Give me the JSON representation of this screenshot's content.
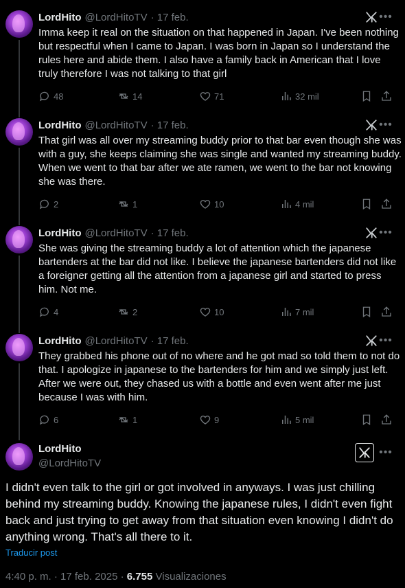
{
  "author": {
    "name": "LordHito",
    "handle": "@LordHitoTV"
  },
  "thread": [
    {
      "date": "· 17 feb.",
      "text": "Imma keep it real on the situation on that happened in Japan. I've been nothing but respectful when I came to Japan. I was born in Japan so I understand the rules here and abide them. I also have a family back in American that I love truly therefore I was not talking to that girl",
      "replies": "48",
      "reposts": "14",
      "likes": "71",
      "views": "32 mil"
    },
    {
      "date": "· 17 feb.",
      "text": "That girl was all over my streaming buddy prior to that bar even though she was with a guy, she keeps claiming she was single and wanted my streaming buddy. When we went to that bar after we ate ramen, we went to the bar not knowing she was there.",
      "replies": "2",
      "reposts": "1",
      "likes": "10",
      "views": "4 mil"
    },
    {
      "date": "· 17 feb.",
      "text": "She was giving the streaming buddy a lot of attention which the japanese bartenders at the bar did not like. I believe the japanese bartenders did not like a foreigner getting all the attention from a japanese girl and started to press him. Not me.",
      "replies": "4",
      "reposts": "2",
      "likes": "10",
      "views": "7 mil"
    },
    {
      "date": "· 17 feb.",
      "text": "They grabbed his phone out of no where and he got mad so told them to not do that. I apologize in japanese to the bartenders for him and we simply just left. After we were out, they chased us with a bottle and even went after me just because I was with him.",
      "replies": "6",
      "reposts": "1",
      "likes": "9",
      "views": "5 mil"
    }
  ],
  "main_post": {
    "text": "I didn't even talk to the girl or got involved in anyways. I was just chilling behind my streaming buddy. Knowing the japanese rules, I didn't even fight back and just trying to get away from that situation even knowing I didn't do anything wrong. That's all there to it.",
    "translate_label": "Traducir post",
    "time": "4:40 p. m. · 17 feb. 2025 · ",
    "views_count": "6.755",
    "views_label": "Visualizaciones"
  },
  "colors": {
    "background": "#000000",
    "text": "#e7e9ea",
    "muted": "#71767b",
    "link": "#1d9bf0"
  },
  "icons": [
    "reply-icon",
    "repost-icon",
    "like-icon",
    "views-icon",
    "bookmark-icon",
    "share-icon",
    "grok-icon",
    "more-icon"
  ]
}
